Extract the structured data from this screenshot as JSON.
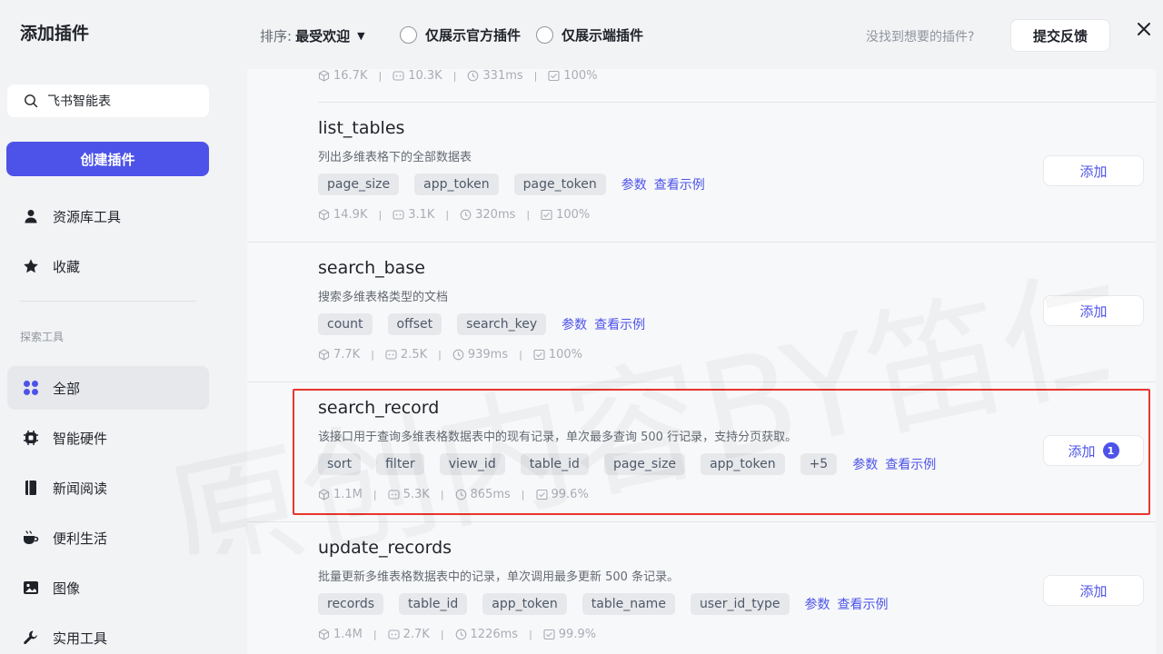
{
  "sidebar": {
    "title": "添加插件",
    "search_value": "飞书智能表",
    "create_label": "创建插件",
    "items": [
      {
        "label": "资源库工具",
        "icon": "user-icon"
      },
      {
        "label": "收藏",
        "icon": "star-icon"
      }
    ],
    "section_label": "探索工具",
    "categories": [
      {
        "label": "全部",
        "icon": "grid-icon",
        "active": true
      },
      {
        "label": "智能硬件",
        "icon": "chip-icon"
      },
      {
        "label": "新闻阅读",
        "icon": "book-icon"
      },
      {
        "label": "便利生活",
        "icon": "cup-icon"
      },
      {
        "label": "图像",
        "icon": "image-icon"
      },
      {
        "label": "实用工具",
        "icon": "wrench-icon"
      }
    ]
  },
  "topbar": {
    "sort_label": "排序:",
    "sort_value": "最受欢迎",
    "filter_official": "仅展示官方插件",
    "filter_device": "仅展示端插件",
    "not_found": "没找到想要的插件?",
    "feedback_label": "提交反馈"
  },
  "colors": {
    "accent": "#4d53e8",
    "highlight": "#e8352d"
  },
  "partial_stats": {
    "downloads": "16.7K",
    "calls": "10.3K",
    "latency": "331ms",
    "success": "100%"
  },
  "plugins": [
    {
      "name": "list_tables",
      "desc": "列出多维表格下的全部数据表",
      "tags": [
        "page_size",
        "app_token",
        "page_token"
      ],
      "param_link": "参数",
      "example_link": "查看示例",
      "downloads": "14.9K",
      "calls": "3.1K",
      "latency": "320ms",
      "success": "100%",
      "add_label": "添加"
    },
    {
      "name": "search_base",
      "desc": "搜索多维表格类型的文档",
      "tags": [
        "count",
        "offset",
        "search_key"
      ],
      "param_link": "参数",
      "example_link": "查看示例",
      "downloads": "7.7K",
      "calls": "2.5K",
      "latency": "939ms",
      "success": "100%",
      "add_label": "添加"
    },
    {
      "name": "search_record",
      "desc": "该接口用于查询多维表格数据表中的现有记录，单次最多查询 500 行记录，支持分页获取。",
      "tags": [
        "sort",
        "filter",
        "view_id",
        "table_id",
        "page_size",
        "app_token",
        "+5"
      ],
      "param_link": "参数",
      "example_link": "查看示例",
      "downloads": "1.1M",
      "calls": "5.3K",
      "latency": "865ms",
      "success": "99.6%",
      "add_label": "添加",
      "badge": "1"
    },
    {
      "name": "update_records",
      "desc": "批量更新多维表格数据表中的记录，单次调用最多更新 500 条记录。",
      "tags": [
        "records",
        "table_id",
        "app_token",
        "table_name",
        "user_id_type"
      ],
      "param_link": "参数",
      "example_link": "查看示例",
      "downloads": "1.4M",
      "calls": "2.7K",
      "latency": "1226ms",
      "success": "99.9%",
      "add_label": "添加"
    }
  ],
  "watermark_text": "原创内容BY笛仁杰"
}
